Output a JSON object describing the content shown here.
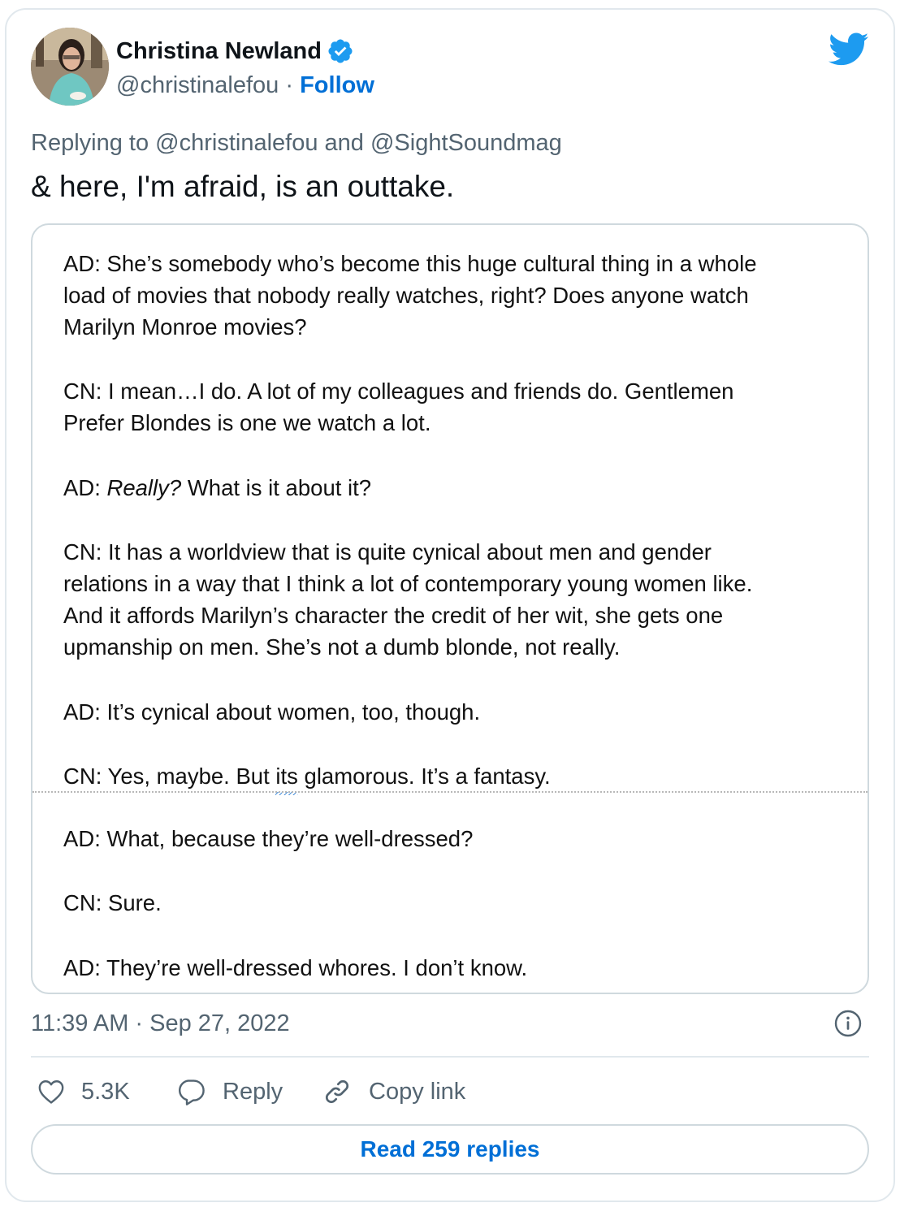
{
  "author": {
    "name": "Christina Newland",
    "handle": "@christinalefou",
    "separator": " · ",
    "follow_label": "Follow"
  },
  "tweet": {
    "replying_prefix": "Replying to ",
    "reply_to_1": "@christinalefou",
    "reply_and": " and ",
    "reply_to_2": "@SightSoundmag",
    "text": "& here, I'm afraid, is an outtake."
  },
  "document": {
    "l1": "AD: She’s somebody who’s become this huge cultural thing in a whole",
    "l2": "load of movies that nobody really watches, right? Does anyone watch",
    "l3": "Marilyn Monroe movies?",
    "l4": "CN: I mean…I do. A lot of my colleagues and friends do. Gentlemen",
    "l5": "Prefer Blondes is one we watch a lot.",
    "l6_prefix": "AD: ",
    "l6_italic": "Really?",
    "l6_rest": " What is it about it?",
    "l7": "CN: It has a worldview that is quite cynical about men and gender",
    "l8": "relations in a way that I think a lot of contemporary young women like.",
    "l9": "And it affords Marilyn’s character the credit of her wit, she gets one",
    "l10": "upmanship on men. She’s not a dumb blonde, not really.",
    "l11": "AD: It’s cynical about women, too, though.",
    "l12_prefix": "CN: Yes, maybe. But ",
    "l12_misspelled": "its",
    "l12_rest": " glamorous. It’s a fantasy.",
    "l13": "AD: What, because they’re well-dressed?",
    "l14": "CN: Sure.",
    "l15": "AD: They’re well-dressed whores. I don’t know."
  },
  "timestamp": "11:39 AM · Sep 27, 2022",
  "actions": {
    "likes": "5.3K",
    "reply_label": "Reply",
    "copy_label": "Copy link"
  },
  "read_replies_label": "Read 259 replies",
  "colors": {
    "link": "#006fd6",
    "twitter_blue": "#1d9bf0",
    "muted": "#536471",
    "border": "#cfd9de"
  },
  "icons": [
    "verified-badge-icon",
    "twitter-bird-icon",
    "info-icon",
    "heart-icon",
    "reply-bubble-icon",
    "link-icon"
  ]
}
